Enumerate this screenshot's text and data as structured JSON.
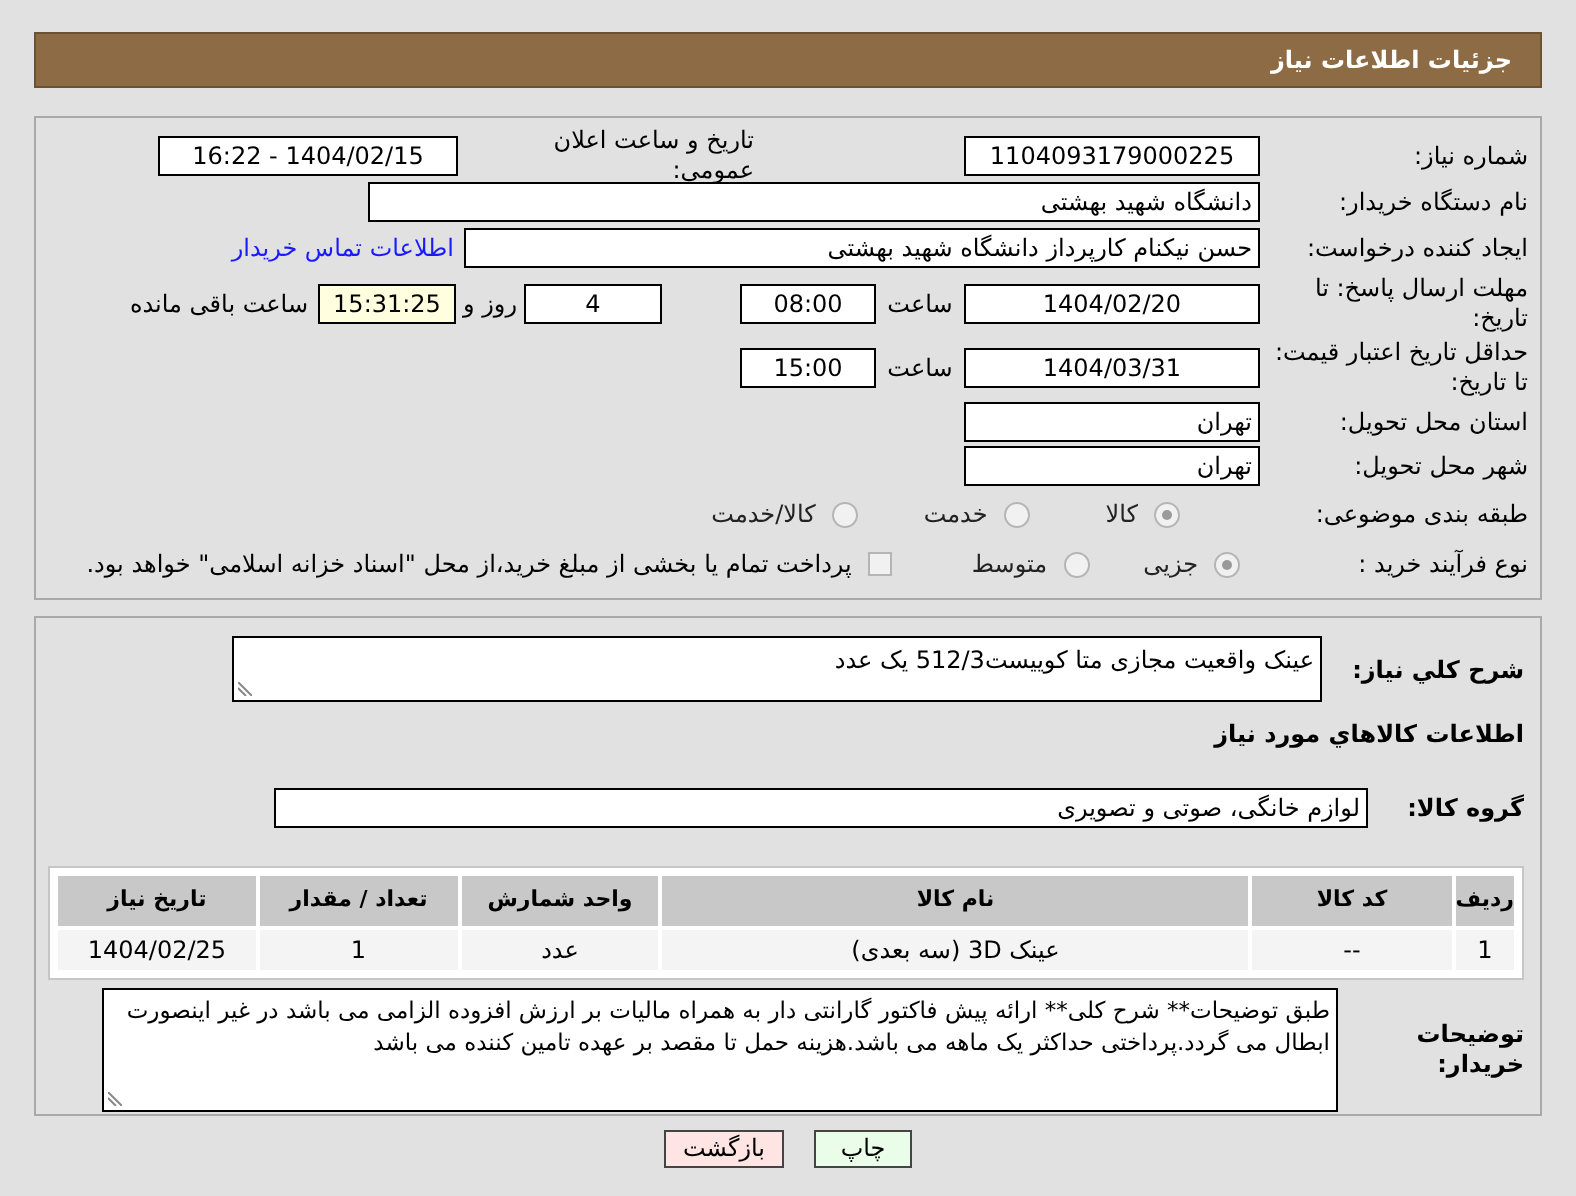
{
  "header": {
    "title": "جزئیات اطلاعات نیاز"
  },
  "need_number": {
    "label": "شماره نیاز:",
    "value": "1104093179000225"
  },
  "announce_datetime": {
    "label": "تاریخ و ساعت اعلان عمومی:",
    "value": "1404/02/15 - 16:22"
  },
  "buyer_org": {
    "label": "نام دستگاه خریدار:",
    "value": "دانشگاه شهید بهشتی"
  },
  "requester": {
    "label": "ایجاد کننده درخواست:",
    "value": "حسن نیکنام کارپرداز دانشگاه شهید بهشتی",
    "contact_link": "اطلاعات تماس خریدار"
  },
  "response_deadline": {
    "label": "مهلت ارسال پاسخ: تا تاریخ:",
    "date": "1404/02/20",
    "time_label": "ساعت",
    "time": "08:00",
    "days": "4",
    "days_suffix": "روز و",
    "remaining": "15:31:25",
    "remaining_suffix": "ساعت باقی مانده"
  },
  "price_validity": {
    "label": "حداقل تاریخ اعتبار قیمت: تا تاریخ:",
    "date": "1404/03/31",
    "time_label": "ساعت",
    "time": "15:00"
  },
  "delivery_province": {
    "label": "استان محل تحویل:",
    "value": "تهران"
  },
  "delivery_city": {
    "label": "شهر محل تحویل:",
    "value": "تهران"
  },
  "category": {
    "label": "طبقه بندی موضوعی:",
    "options": [
      {
        "label": "کالا",
        "selected": true
      },
      {
        "label": "خدمت",
        "selected": false
      },
      {
        "label": "کالا/خدمت",
        "selected": false
      }
    ]
  },
  "purchase_process": {
    "label": "نوع فرآیند خرید :",
    "options": [
      {
        "label": "جزیی",
        "selected": true
      },
      {
        "label": "متوسط",
        "selected": false
      }
    ],
    "treasury_payment": {
      "label": "پرداخت تمام یا بخشی از مبلغ خرید،از محل \"اسناد خزانه اسلامی\" خواهد بود.",
      "checked": false
    }
  },
  "description": {
    "label": "شرح کلي نياز:",
    "value": "عینک واقعیت مجازی متا کوییست512/3 یک عدد"
  },
  "goods_section_title": "اطلاعات کالاهاي مورد نياز",
  "goods_group": {
    "label": "گروه کالا:",
    "value": "لوازم خانگی، صوتی و تصویری"
  },
  "table": {
    "columns": [
      "ردیف",
      "کد کالا",
      "نام کالا",
      "واحد شمارش",
      "تعداد / مقدار",
      "تاریخ نیاز"
    ],
    "rows": [
      [
        "1",
        "--",
        "عینک 3D (سه بعدی)",
        "عدد",
        "1",
        "1404/02/25"
      ]
    ]
  },
  "buyer_notes": {
    "label": "توضیحات خریدار:",
    "value": "طبق توضیحات** شرح کلی** ارائه پیش فاکتور  گارانتی دار به همراه مالیات بر ارزش افزوده الزامی می باشد در غیر اینصورت ابطال می گردد.پرداختی حداکثر یک ماهه می باشد.هزینه حمل تا مقصد بر عهده تامین کننده می باشد"
  },
  "buttons": [
    {
      "label": "چاپ",
      "kind": "print"
    },
    {
      "label": "بازگشت",
      "kind": "back"
    }
  ]
}
